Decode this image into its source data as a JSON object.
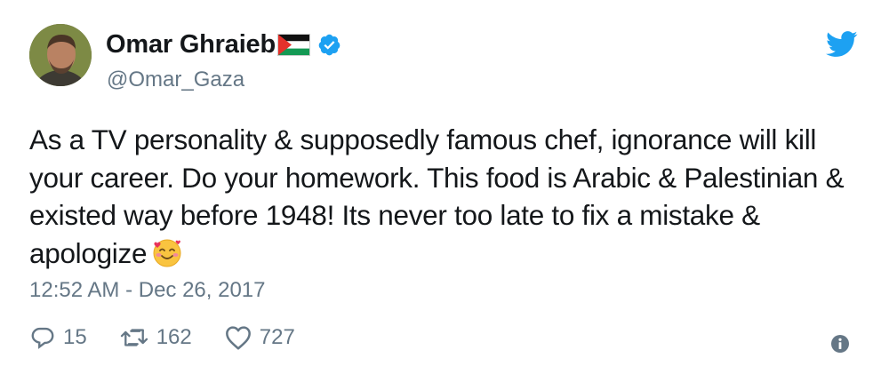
{
  "user": {
    "display_name": "Omar Ghraieb",
    "handle": "@Omar_Gaza",
    "flag_icon": "palestine-flag-icon",
    "verified_icon": "verified-badge-icon"
  },
  "tweet": {
    "text": "As a TV personality & supposedly famous chef, ignorance will kill your career. Do your homework. This food is Arabic & Palestinian & existed way before 1948! Its never too late to fix a mistake & apologize",
    "emoji": "smiling-face-with-hearts-emoji",
    "timestamp": "12:52 AM - Dec 26, 2017"
  },
  "actions": {
    "reply_count": "15",
    "retweet_count": "162",
    "like_count": "727"
  },
  "icons": {
    "brand": "twitter-bird-icon",
    "info": "info-icon"
  },
  "colors": {
    "twitter_blue": "#1da1f2",
    "text_primary": "#14171a",
    "text_secondary": "#657786"
  }
}
